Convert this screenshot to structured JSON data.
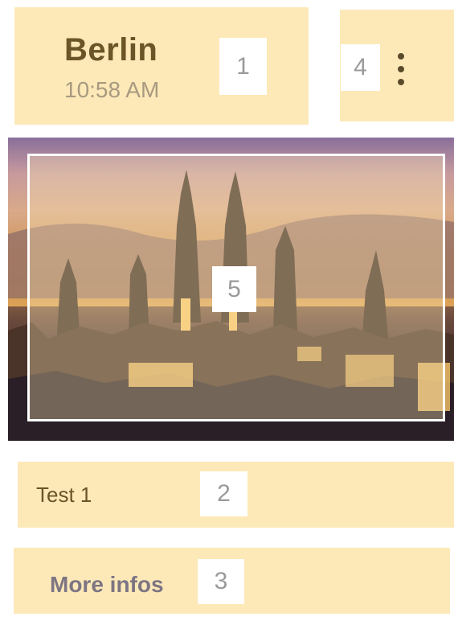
{
  "header": {
    "city": "Berlin",
    "time": "10:58 AM"
  },
  "menu": {
    "icon": "more-vert-icon"
  },
  "image": {
    "subject": "city-skyline-image"
  },
  "item": {
    "title": "Test 1"
  },
  "action": {
    "more_label": "More infos"
  },
  "markers": {
    "m1": "1",
    "m2": "2",
    "m3": "3",
    "m4": "4",
    "m5": "5"
  },
  "colors": {
    "highlight": "#fde9b8",
    "title": "#6b5528",
    "subtitle": "#a89a80",
    "button": "#7d7583"
  }
}
